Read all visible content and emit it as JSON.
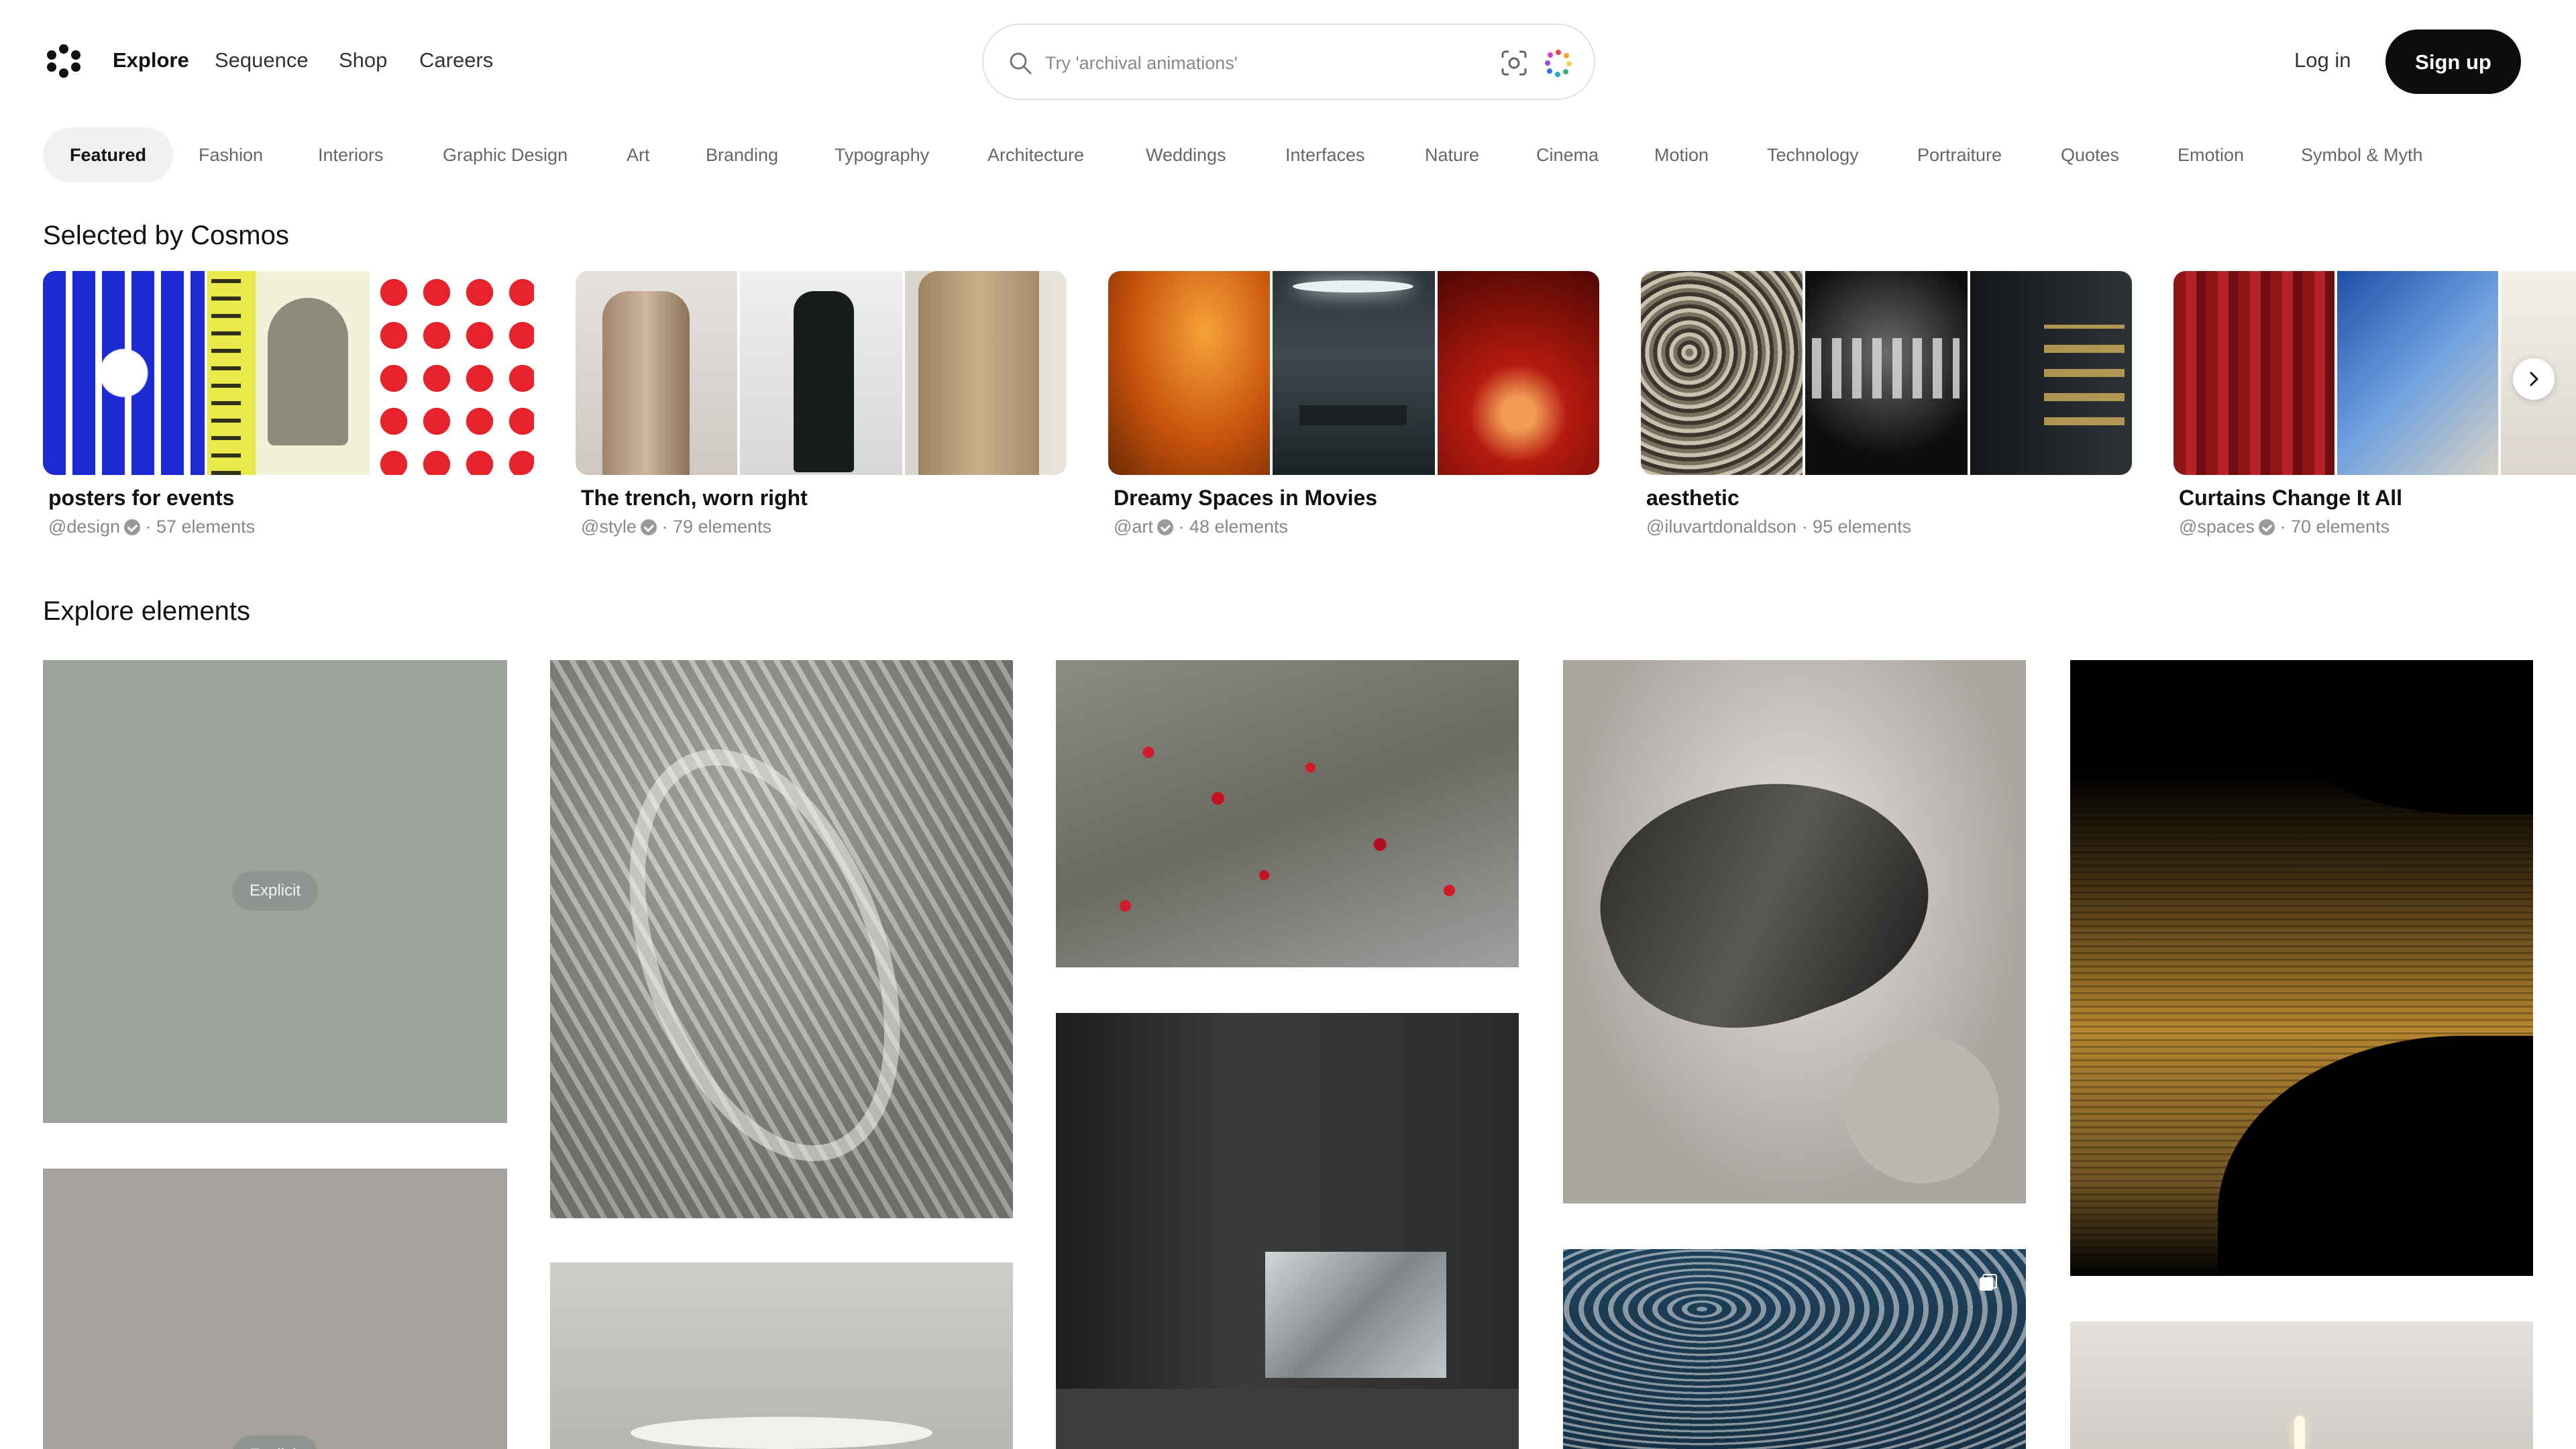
{
  "header": {
    "nav": [
      {
        "label": "Explore",
        "active": true
      },
      {
        "label": "Sequence"
      },
      {
        "label": "Shop"
      },
      {
        "label": "Careers"
      }
    ],
    "search": {
      "placeholder": "Try 'archival animations'"
    },
    "login_label": "Log in",
    "signup_label": "Sign up",
    "icons": [
      "logo-icon",
      "search-icon",
      "visual-search-icon",
      "ai-spark-icon"
    ]
  },
  "categories": [
    {
      "label": "Featured",
      "active": true
    },
    {
      "label": "Fashion"
    },
    {
      "label": "Interiors"
    },
    {
      "label": "Graphic Design"
    },
    {
      "label": "Art"
    },
    {
      "label": "Branding"
    },
    {
      "label": "Typography"
    },
    {
      "label": "Architecture"
    },
    {
      "label": "Weddings"
    },
    {
      "label": "Interfaces"
    },
    {
      "label": "Nature"
    },
    {
      "label": "Cinema"
    },
    {
      "label": "Motion"
    },
    {
      "label": "Technology"
    },
    {
      "label": "Portraiture"
    },
    {
      "label": "Quotes"
    },
    {
      "label": "Emotion"
    },
    {
      "label": "Symbol & Myth"
    }
  ],
  "featured": {
    "title": "Selected by Cosmos",
    "collections": [
      {
        "title": "posters for events",
        "handle": "@design",
        "verified": true,
        "count": "· 57 elements"
      },
      {
        "title": "The trench, worn right",
        "handle": "@style",
        "verified": true,
        "count": "· 79 elements"
      },
      {
        "title": "Dreamy Spaces in Movies",
        "handle": "@art",
        "verified": true,
        "count": "· 48 elements"
      },
      {
        "title": "aesthetic",
        "handle": "@iluvartdonaldson",
        "verified": false,
        "count": "· 95 elements"
      },
      {
        "title": "Curtains Change It All",
        "handle": "@spaces",
        "verified": true,
        "count": "· 70 elements"
      }
    ],
    "next_icon": "chevron-right-icon"
  },
  "explore": {
    "title": "Explore elements",
    "explicit_label": "Explicit"
  },
  "colors": {
    "accent": "#0c0c0c",
    "tab_bg": "#f0f0f0",
    "muted_text": "#888888"
  }
}
